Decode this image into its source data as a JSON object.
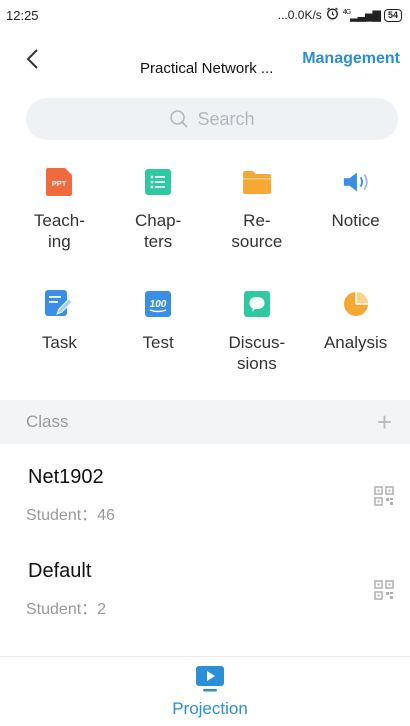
{
  "status": {
    "time": "12:25",
    "speed": "...0.0K/s",
    "signal": "4G",
    "battery": "54"
  },
  "header": {
    "title": "Practical Network ...",
    "action": "Management"
  },
  "search": {
    "placeholder": "Search"
  },
  "features": [
    {
      "label": "Teach-\ning",
      "icon": "ppt-icon",
      "color": "#f06a3d"
    },
    {
      "label": "Chap-\nters",
      "icon": "list-icon",
      "color": "#2ec9a1"
    },
    {
      "label": "Re-\nsource",
      "icon": "folder-icon",
      "color": "#f7a833"
    },
    {
      "label": "Notice",
      "icon": "speaker-icon",
      "color": "#3a8ee6"
    },
    {
      "label": "Task",
      "icon": "task-edit-icon",
      "color": "#3a8ee6"
    },
    {
      "label": "Test",
      "icon": "test-score-icon",
      "color": "#3a8ee6"
    },
    {
      "label": "Discus-\nsions",
      "icon": "chat-icon",
      "color": "#2ec9a1"
    },
    {
      "label": "Analysis",
      "icon": "pie-chart-icon",
      "color": "#f7a833"
    }
  ],
  "class_section": {
    "title": "Class",
    "add": "+"
  },
  "classes": [
    {
      "name": "Net1902",
      "students": "Student：46"
    },
    {
      "name": "Default",
      "students": "Student：2"
    }
  ],
  "tabbar": {
    "projection": "Projection"
  },
  "colors": {
    "accent": "#2a8fd6"
  }
}
